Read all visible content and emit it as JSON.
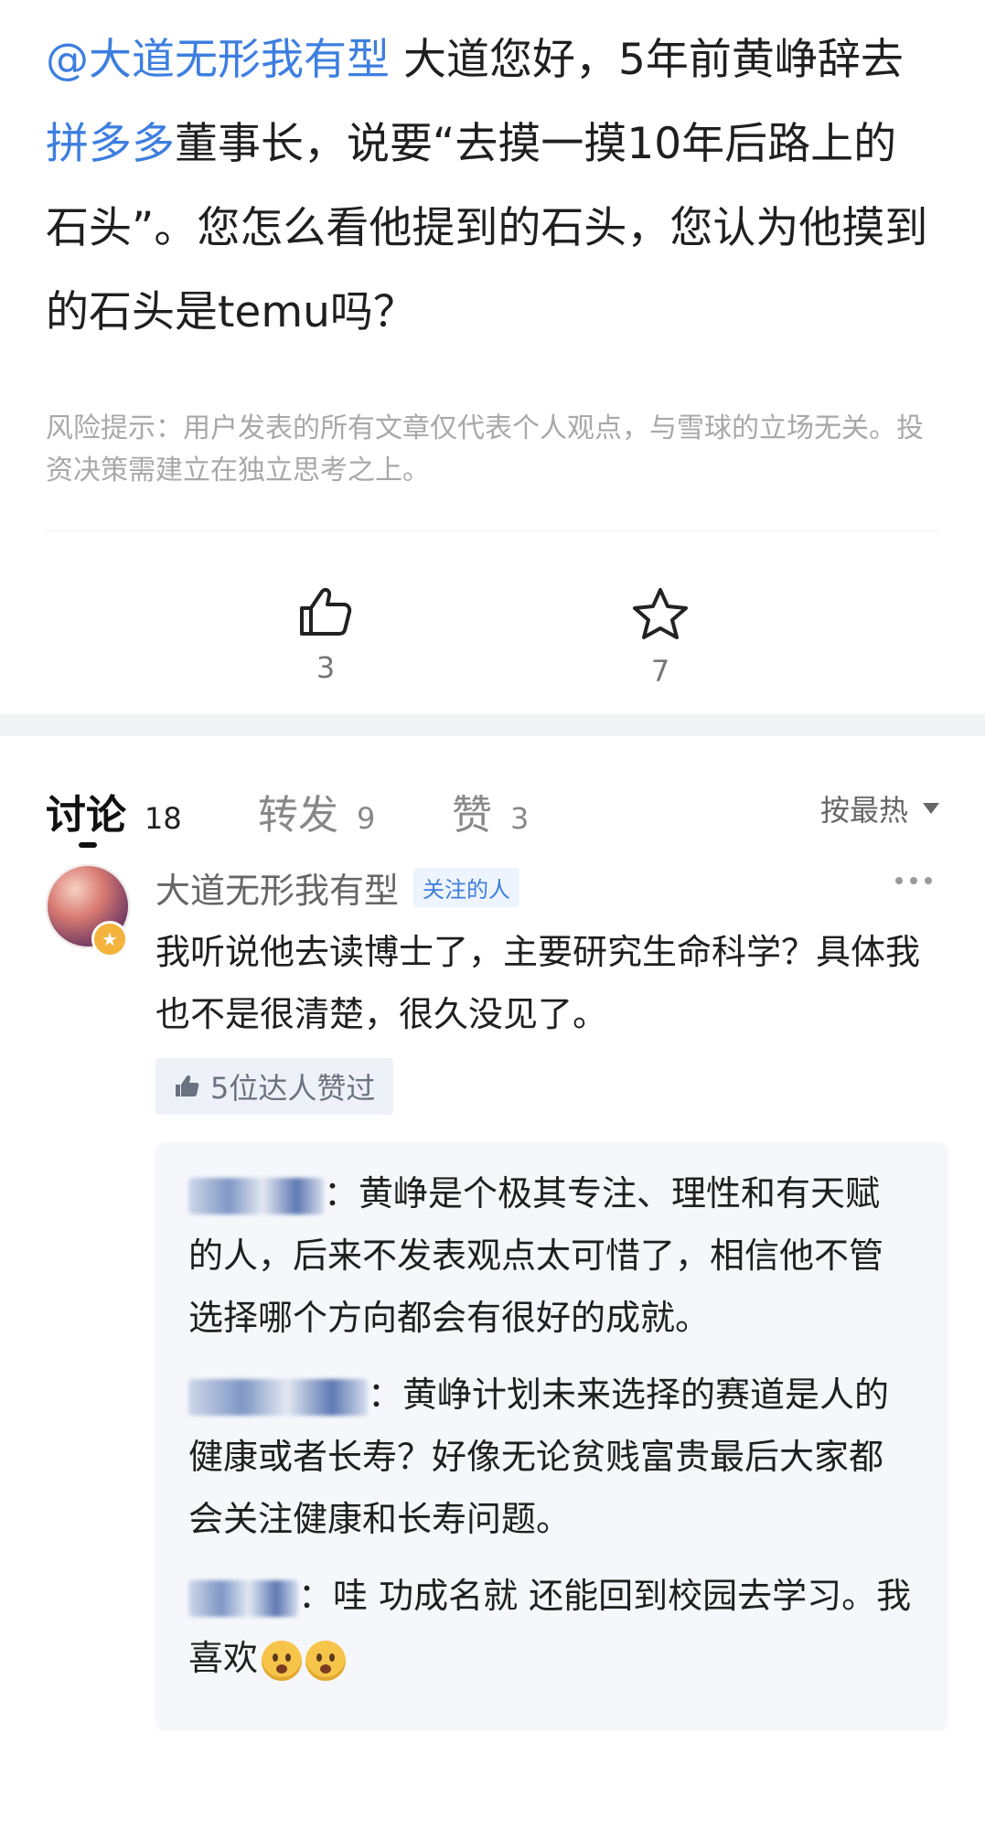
{
  "post": {
    "mention": "@大道无形我有型",
    "text_a": " 大道您好，5年前黄峥辞去",
    "company_link": "拼多多",
    "text_b": "董事长，说要“去摸一摸10年后路上的石头”。您怎么看他提到的石头，您认为他摸到的石头是temu吗？",
    "risk_notice": "风险提示：用户发表的所有文章仅代表个人观点，与雪球的立场无关。投资决策需建立在独立思考之上。"
  },
  "actions": {
    "like": {
      "icon": "thumbs-up-icon",
      "count": "3"
    },
    "favorite": {
      "icon": "star-icon",
      "count": "7"
    }
  },
  "tabs": [
    {
      "label": "讨论",
      "count": "18",
      "active": true
    },
    {
      "label": "转发",
      "count": "9",
      "active": false
    },
    {
      "label": "赞",
      "count": "3",
      "active": false
    }
  ],
  "sort": {
    "label": "按最热"
  },
  "comment": {
    "author": "大道无形我有型",
    "tag": "关注的人",
    "body": "我听说他去读博士了，主要研究生命科学？具体我也不是很清楚，很久没见了。",
    "likers": "5位达人赞过",
    "replies": [
      {
        "text": "：黄峥是个极其专注、理性和有天赋的人，后来不发表观点太可惜了，相信他不管选择哪个方向都会有很好的成就。"
      },
      {
        "text": "：黄峥计划未来选择的赛道是人的健康或者长寿？好像无论贫贱富贵最后大家都会关注健康和长寿问题。"
      },
      {
        "text": "：哇 功成名就 还能回到校园去学习。我喜欢"
      }
    ]
  },
  "colors": {
    "link": "#3d7ee0",
    "muted": "#a8a8a8",
    "reply_bg": "#f5f7fa"
  }
}
